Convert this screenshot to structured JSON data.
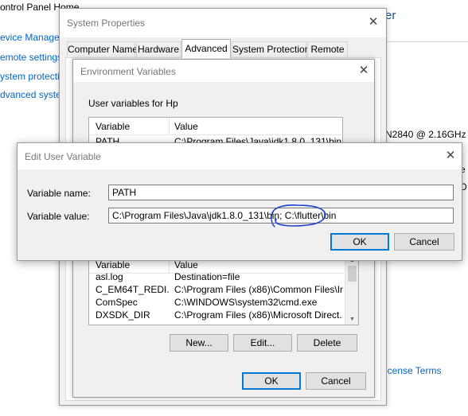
{
  "control_panel": {
    "title": "ontrol Panel Home",
    "links": [
      "evice Manager",
      "emote settings",
      "ystem protectio",
      "dvanced syste"
    ],
    "right_header": "er",
    "cpu": "N2840  @ 2.16GHz",
    "frag1": "e",
    "frag2": "D",
    "license_link": "icense Terms"
  },
  "system_properties": {
    "title": "System Properties",
    "close": "✕",
    "tabs": [
      "Computer Name",
      "Hardware",
      "Advanced",
      "System Protection",
      "Remote"
    ],
    "active_tab": "Advanced"
  },
  "environment_variables": {
    "title": "Environment Variables",
    "close": "✕",
    "user_vars_label": "User variables for Hp",
    "columns": [
      "Variable",
      "Value"
    ],
    "user_rows": [
      {
        "variable": "PATH",
        "value": "C:\\Program Files\\Java\\jdk1.8.0_131\\bin"
      }
    ],
    "system_rows": [
      {
        "variable": "asl.log",
        "value": "Destination=file"
      },
      {
        "variable": "C_EM64T_REDI...",
        "value": "C:\\Program Files (x86)\\Common Files\\In..."
      },
      {
        "variable": "ComSpec",
        "value": "C:\\WINDOWS\\system32\\cmd.exe"
      },
      {
        "variable": "DXSDK_DIR",
        "value": "C:\\Program Files (x86)\\Microsoft Direct..."
      }
    ],
    "buttons": {
      "new": "New...",
      "edit": "Edit...",
      "delete": "Delete"
    },
    "ok": "OK",
    "cancel": "Cancel"
  },
  "edit_user_variable": {
    "title": "Edit User Variable",
    "close": "✕",
    "name_label": "Variable name:",
    "name_value": "PATH",
    "value_label": "Variable value:",
    "value_value": "C:\\Program Files\\Java\\jdk1.8.0_131\\bin; C:\\flutter\\bin",
    "ok": "OK",
    "cancel": "Cancel"
  },
  "colors": {
    "accent": "#0078d7",
    "link": "#0066cc",
    "annotation_ink": "#1a3fd6"
  },
  "icons": {
    "close": "close-icon",
    "scroll_up": "scroll-up-arrow-icon",
    "scroll_down": "scroll-down-arrow-icon"
  }
}
